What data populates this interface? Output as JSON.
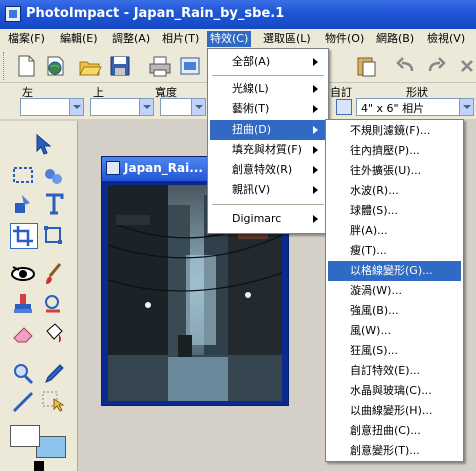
{
  "window": {
    "title": "PhotoImpact - Japan_Rain_by_sbe.1"
  },
  "menubar": [
    {
      "label": "檔案(F)"
    },
    {
      "label": "編輯(E)"
    },
    {
      "label": "調整(A)"
    },
    {
      "label": "相片(T)"
    },
    {
      "label": "特效(C)",
      "active": true
    },
    {
      "label": "選取區(L)"
    },
    {
      "label": "物件(O)"
    },
    {
      "label": "網路(B)"
    },
    {
      "label": "檢視(V)"
    }
  ],
  "attrbar": {
    "left_label": "左",
    "top_label": "上",
    "width_label": "寬度",
    "unit_label": "自訂",
    "shape_label": "形狀",
    "photo_size_value": "4\" x 6\" 相片"
  },
  "document": {
    "title": "Japan_Rai..."
  },
  "effects_menu": [
    {
      "label": "全部(A)",
      "submenu": true
    },
    {
      "label": "光線(L)",
      "submenu": true
    },
    {
      "label": "藝術(T)",
      "submenu": true
    },
    {
      "label": "扭曲(D)",
      "submenu": true,
      "highlighted": true
    },
    {
      "label": "填充與材質(F)",
      "submenu": true
    },
    {
      "label": "創意特效(R)",
      "submenu": true
    },
    {
      "label": "親訊(V)",
      "submenu": true
    },
    {
      "label": "Digimarc",
      "submenu": true
    }
  ],
  "distort_menu": [
    {
      "label": "不規則濾鏡(F)..."
    },
    {
      "label": "往內擠壓(P)..."
    },
    {
      "label": "往外擴張(U)..."
    },
    {
      "label": "水波(R)..."
    },
    {
      "label": "球體(S)..."
    },
    {
      "label": "胖(A)..."
    },
    {
      "label": "瘦(T)..."
    },
    {
      "label": "以格線變形(G)...",
      "highlighted": true
    },
    {
      "label": "漩渦(W)..."
    },
    {
      "label": "強風(B)..."
    },
    {
      "label": "風(W)..."
    },
    {
      "label": "狂風(S)..."
    },
    {
      "label": "自訂特效(E)..."
    },
    {
      "label": "水晶與玻璃(C)..."
    },
    {
      "label": "以曲線變形(H)..."
    },
    {
      "label": "創意扭曲(C)..."
    },
    {
      "label": "創意變形(T)..."
    }
  ],
  "toolbar_icons": [
    "new-file-icon",
    "open-web-icon",
    "open-folder-icon",
    "save-icon",
    "print-icon",
    "scan-icon",
    "paste-icon",
    "undo-icon",
    "redo-icon",
    "close-x-icon"
  ],
  "tool_icons": [
    "pick-tool-icon",
    "transform-tool-icon",
    "standard-selection-icon",
    "lasso-icon",
    "path-drawing-icon",
    "text-tool-icon",
    "crop-tool-icon",
    "resize-tool-icon",
    "red-eye-icon",
    "paintbrush-icon",
    "clone-stamp-icon",
    "retouch-icon",
    "eraser-icon",
    "fill-icon",
    "zoom-icon",
    "eyedropper-icon",
    "line-tool-icon",
    "stitch-icon"
  ],
  "colors": {
    "accent": "#316ac5",
    "titlebar": "#1f57d6",
    "background_swatch": "#8cc4ee"
  }
}
